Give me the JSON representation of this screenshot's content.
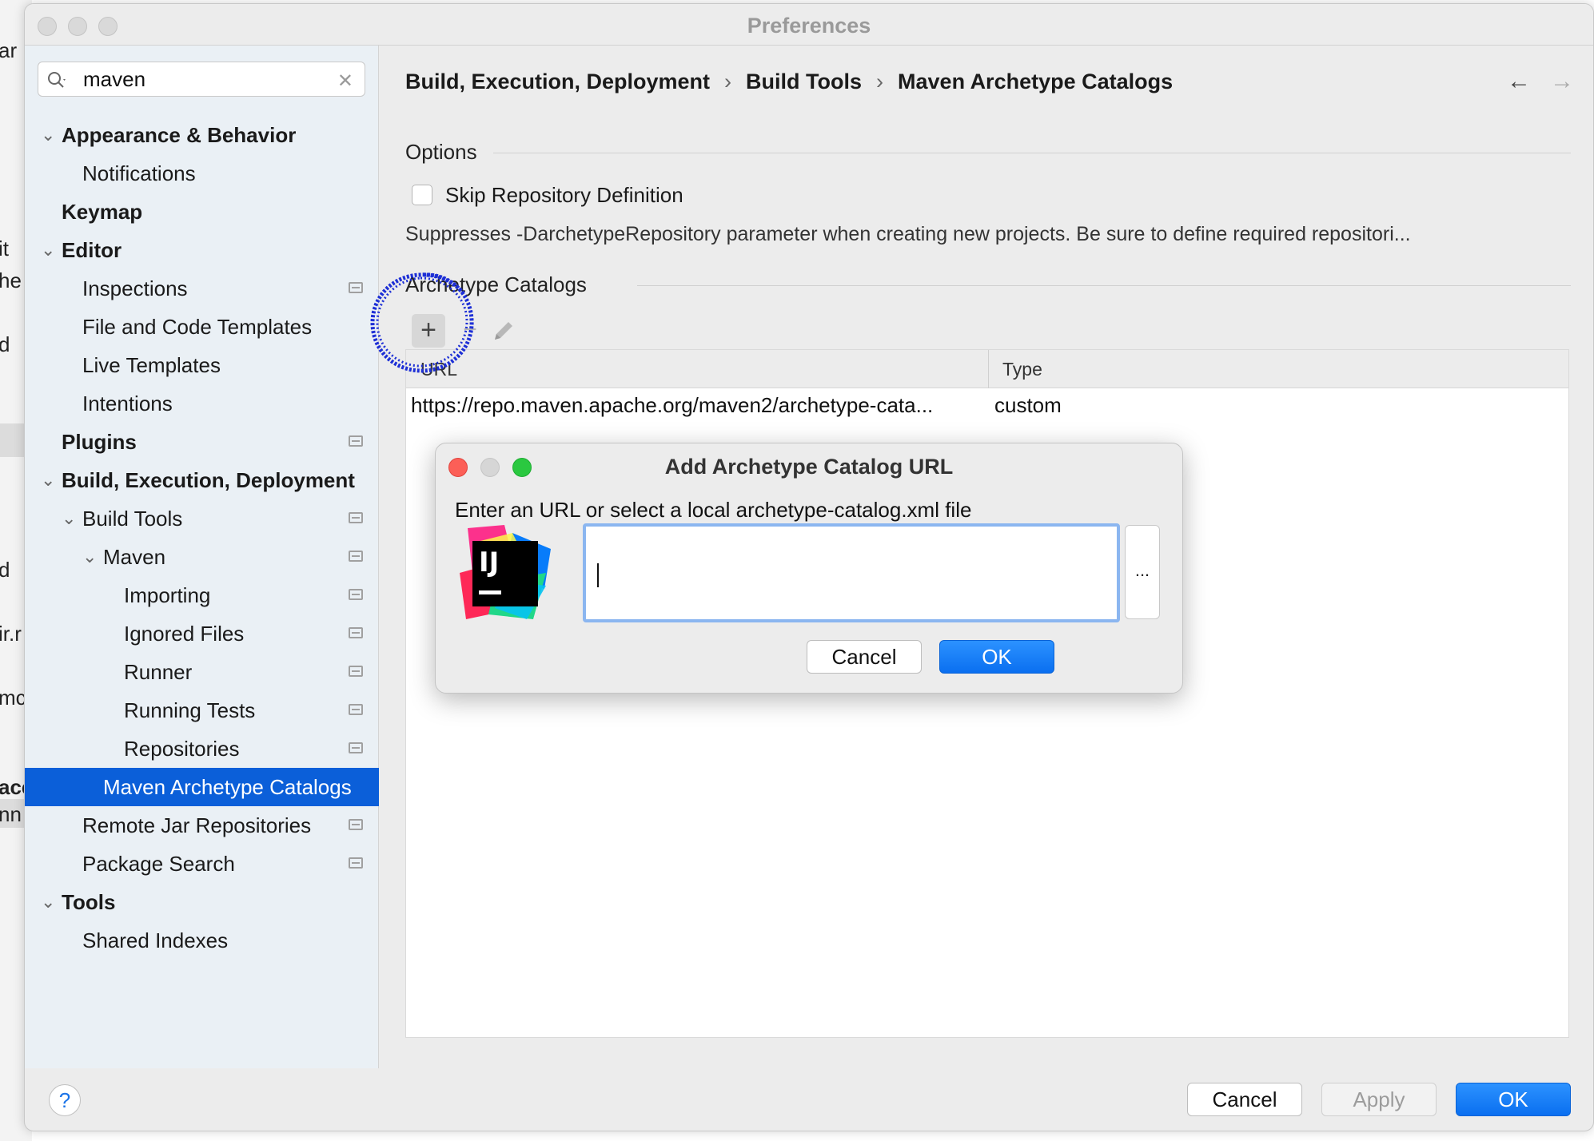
{
  "background_app": {
    "fragments": [
      "ar",
      "it",
      "he",
      "d",
      "d",
      "ir.r",
      "mc",
      "ace",
      "nn"
    ]
  },
  "window": {
    "title": "Preferences"
  },
  "sidebar": {
    "search": {
      "value": "maven"
    },
    "items": [
      {
        "label": "Appearance & Behavior"
      },
      {
        "label": "Notifications"
      },
      {
        "label": "Keymap"
      },
      {
        "label": "Editor"
      },
      {
        "label": "Inspections"
      },
      {
        "label": "File and Code Templates"
      },
      {
        "label": "Live Templates"
      },
      {
        "label": "Intentions"
      },
      {
        "label": "Plugins"
      },
      {
        "label": "Build, Execution, Deployment"
      },
      {
        "label": "Build Tools"
      },
      {
        "label": "Maven"
      },
      {
        "label": "Importing"
      },
      {
        "label": "Ignored Files"
      },
      {
        "label": "Runner"
      },
      {
        "label": "Running Tests"
      },
      {
        "label": "Repositories"
      },
      {
        "label": "Maven Archetype Catalogs"
      },
      {
        "label": "Remote Jar Repositories"
      },
      {
        "label": "Package Search"
      },
      {
        "label": "Tools"
      },
      {
        "label": "Shared Indexes"
      }
    ]
  },
  "breadcrumb": [
    "Build, Execution, Deployment",
    "Build Tools",
    "Maven Archetype Catalogs"
  ],
  "options": {
    "title": "Options",
    "skip_label": "Skip Repository Definition",
    "skip_checked": false,
    "description": "Suppresses -DarchetypeRepository parameter when creating new projects. Be sure to define required repositori..."
  },
  "catalogs": {
    "title": "Archetype Catalogs",
    "columns": [
      "URL",
      "Type"
    ],
    "rows": [
      {
        "url": "https://repo.maven.apache.org/maven2/archetype-cata...",
        "type": "custom"
      }
    ]
  },
  "footer": {
    "help": "?",
    "cancel": "Cancel",
    "apply": "Apply",
    "ok": "OK"
  },
  "dialog": {
    "title": "Add Archetype Catalog URL",
    "prompt": "Enter an URL or select a local archetype-catalog.xml file",
    "input_value": "",
    "browse": "...",
    "logo_text": "IJ",
    "cancel": "Cancel",
    "ok": "OK"
  },
  "colors": {
    "accent": "#0b5fd9",
    "annotation": "#1d2fd6",
    "close": "#fc5f57",
    "zoom": "#2ac840"
  },
  "icons": [
    "search-icon",
    "clear-icon",
    "chevron-down-icon",
    "chevron-right-icon",
    "project-level-icon",
    "back-arrow-icon",
    "forward-arrow-icon",
    "plus-icon",
    "minus-icon",
    "pencil-icon",
    "intellij-logo-icon",
    "help-icon"
  ]
}
